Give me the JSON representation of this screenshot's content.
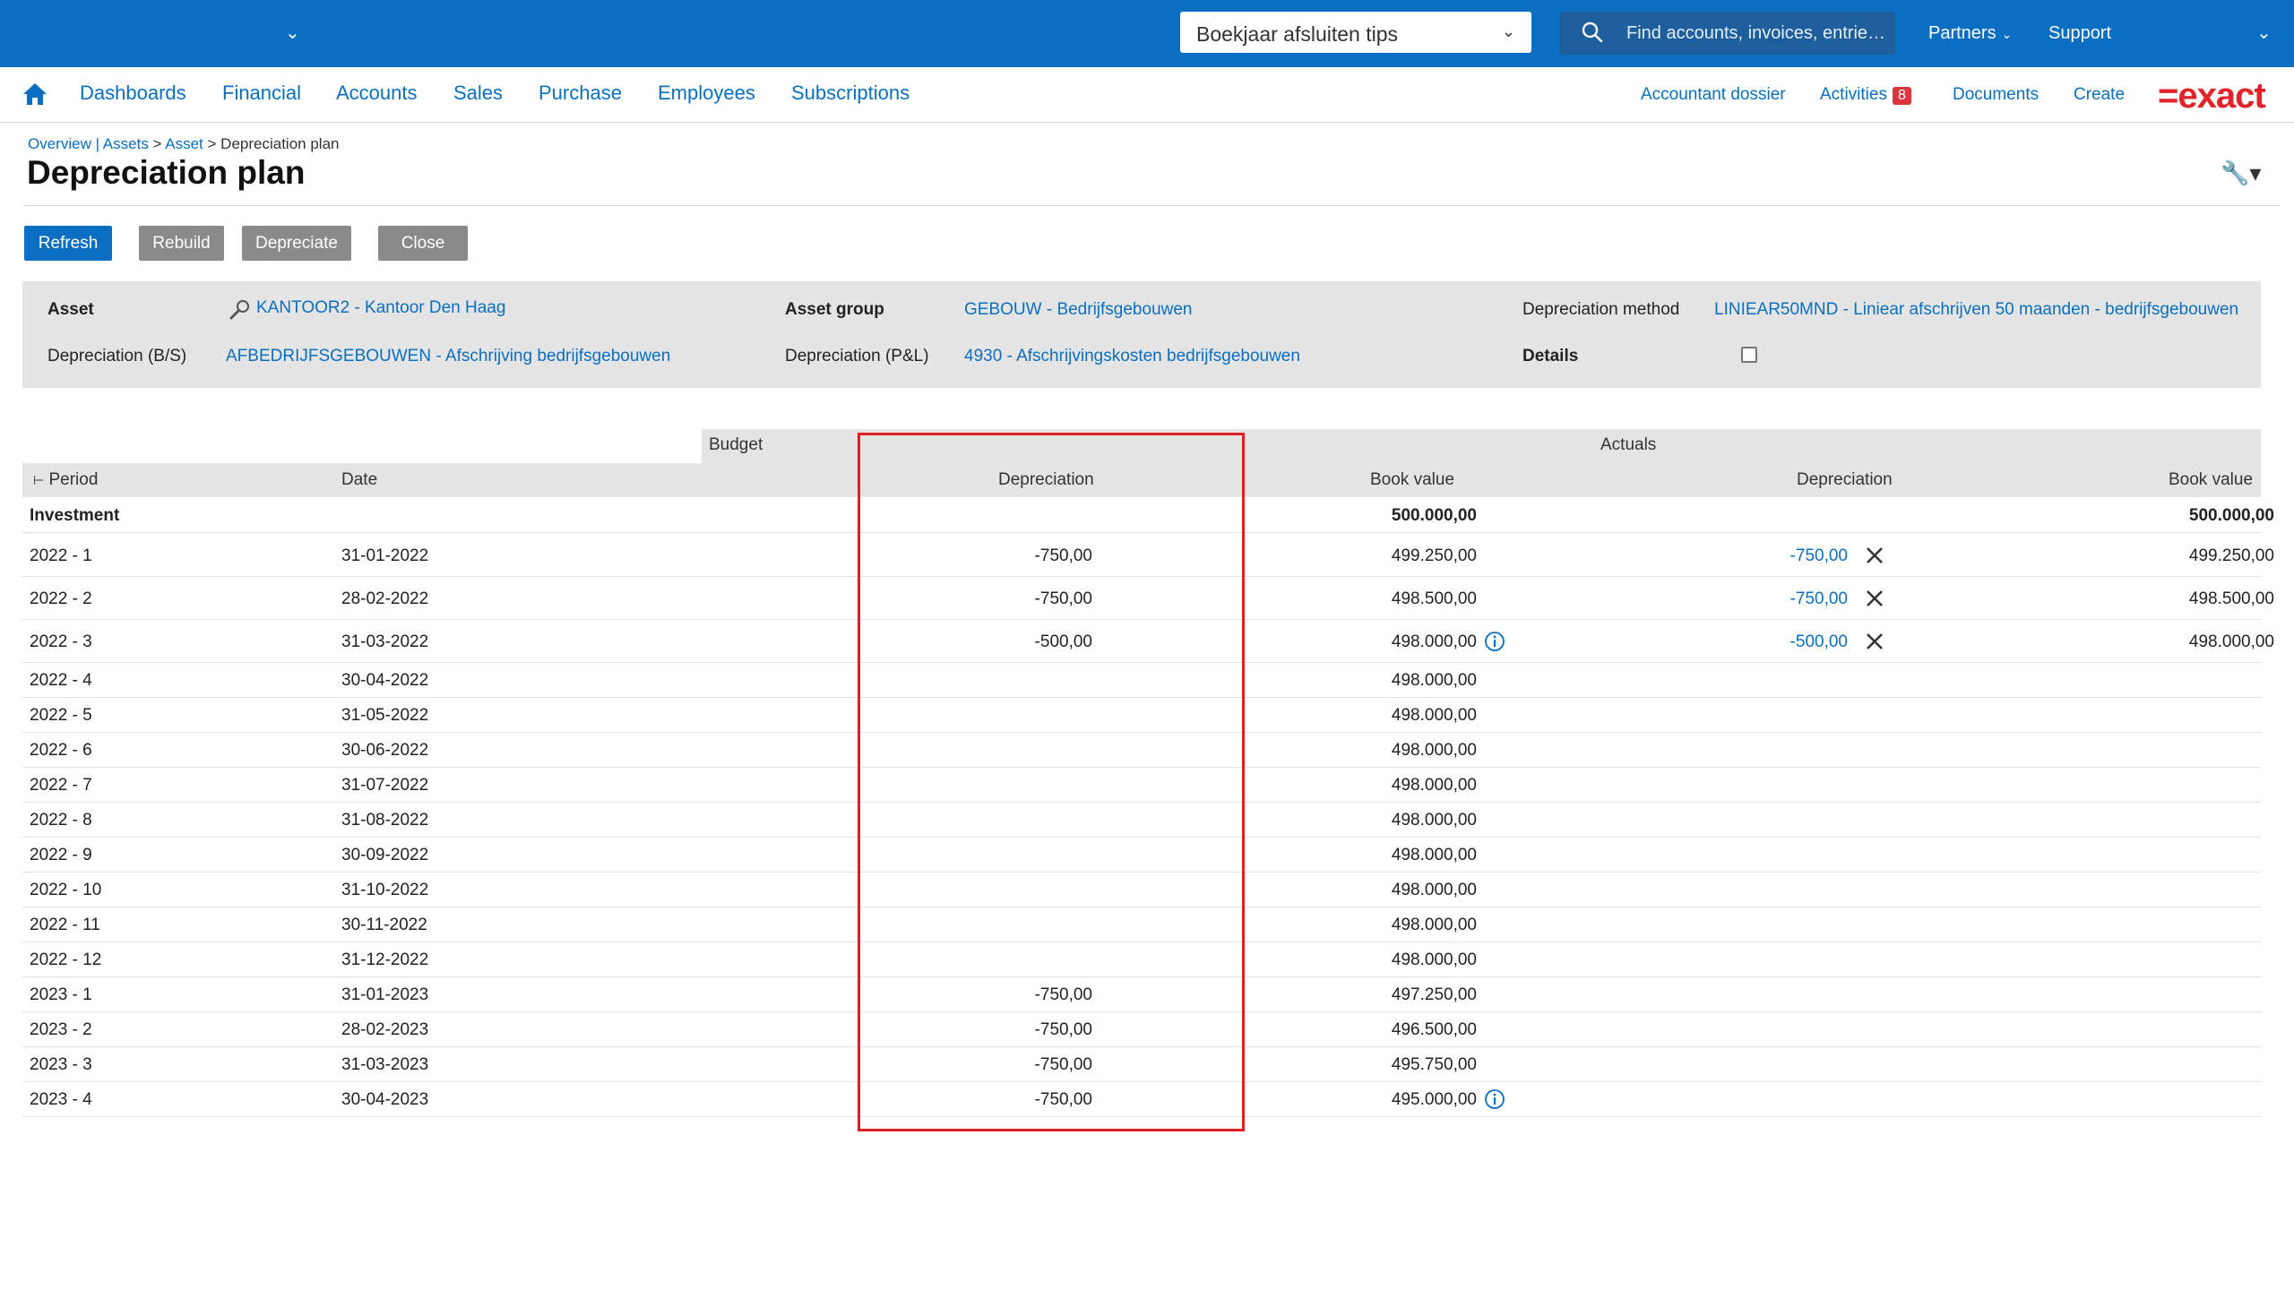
{
  "topbar": {
    "tips_select": "Boekjaar afsluiten tips",
    "search_placeholder": "Find accounts, invoices, entrie…",
    "partners": "Partners",
    "support": "Support"
  },
  "nav": {
    "items": [
      "Dashboards",
      "Financial",
      "Accounts",
      "Sales",
      "Purchase",
      "Employees",
      "Subscriptions"
    ],
    "right": {
      "accountant_dossier": "Accountant dossier",
      "activities": "Activities",
      "activities_count": "8",
      "documents": "Documents",
      "create": "Create"
    },
    "logo": "=exact"
  },
  "breadcrumb": {
    "overview": "Overview",
    "sep1": " | ",
    "assets": "Assets",
    "sep2": " > ",
    "asset": "Asset",
    "sep3": " > ",
    "current": "Depreciation plan"
  },
  "page_title": "Depreciation plan",
  "buttons": {
    "refresh": "Refresh",
    "rebuild": "Rebuild",
    "depreciate": "Depreciate",
    "close": "Close"
  },
  "info": {
    "asset_label": "Asset",
    "asset_value": "KANTOOR2 - Kantoor Den Haag",
    "asset_group_label": "Asset group",
    "asset_group_value": "GEBOUW - Bedrijfsgebouwen",
    "method_label": "Depreciation method",
    "method_value": "LINIEAR50MND - Liniear afschrijven 50 maanden - bedrijfsgebouwen",
    "dep_bs_label": "Depreciation (B/S)",
    "dep_bs_value": "AFBEDRIJFSGEBOUWEN - Afschrijving bedrijfsgebouwen",
    "dep_pl_label": "Depreciation (P&L)",
    "dep_pl_value": "4930 - Afschrijvingskosten bedrijfsgebouwen",
    "details_label": "Details",
    "details_checked": false
  },
  "table": {
    "group_budget": "Budget",
    "group_actuals": "Actuals",
    "headers": {
      "period": "Period",
      "date": "Date",
      "budget_depreciation": "Depreciation",
      "budget_book_value": "Book value",
      "actual_depreciation": "Depreciation",
      "actual_book_value": "Book value"
    },
    "investment": {
      "label": "Investment",
      "budget_book_value": "500.000,00",
      "actual_book_value": "500.000,00"
    },
    "rows": [
      {
        "period": "2022 - 1",
        "date": "31-01-2022",
        "bdep": "-750,00",
        "bbv": "499.250,00",
        "info": false,
        "adep": "-750,00",
        "abv": "499.250,00"
      },
      {
        "period": "2022 - 2",
        "date": "28-02-2022",
        "bdep": "-750,00",
        "bbv": "498.500,00",
        "info": false,
        "adep": "-750,00",
        "abv": "498.500,00"
      },
      {
        "period": "2022 - 3",
        "date": "31-03-2022",
        "bdep": "-500,00",
        "bbv": "498.000,00",
        "info": true,
        "adep": "-500,00",
        "abv": "498.000,00"
      },
      {
        "period": "2022 - 4",
        "date": "30-04-2022",
        "bdep": "",
        "bbv": "498.000,00",
        "info": false,
        "adep": "",
        "abv": ""
      },
      {
        "period": "2022 - 5",
        "date": "31-05-2022",
        "bdep": "",
        "bbv": "498.000,00",
        "info": false,
        "adep": "",
        "abv": ""
      },
      {
        "period": "2022 - 6",
        "date": "30-06-2022",
        "bdep": "",
        "bbv": "498.000,00",
        "info": false,
        "adep": "",
        "abv": ""
      },
      {
        "period": "2022 - 7",
        "date": "31-07-2022",
        "bdep": "",
        "bbv": "498.000,00",
        "info": false,
        "adep": "",
        "abv": ""
      },
      {
        "period": "2022 - 8",
        "date": "31-08-2022",
        "bdep": "",
        "bbv": "498.000,00",
        "info": false,
        "adep": "",
        "abv": ""
      },
      {
        "period": "2022 - 9",
        "date": "30-09-2022",
        "bdep": "",
        "bbv": "498.000,00",
        "info": false,
        "adep": "",
        "abv": ""
      },
      {
        "period": "2022 - 10",
        "date": "31-10-2022",
        "bdep": "",
        "bbv": "498.000,00",
        "info": false,
        "adep": "",
        "abv": ""
      },
      {
        "period": "2022 - 11",
        "date": "30-11-2022",
        "bdep": "",
        "bbv": "498.000,00",
        "info": false,
        "adep": "",
        "abv": ""
      },
      {
        "period": "2022 - 12",
        "date": "31-12-2022",
        "bdep": "",
        "bbv": "498.000,00",
        "info": false,
        "adep": "",
        "abv": ""
      },
      {
        "period": "2023 - 1",
        "date": "31-01-2023",
        "bdep": "-750,00",
        "bbv": "497.250,00",
        "info": false,
        "adep": "",
        "abv": ""
      },
      {
        "period": "2023 - 2",
        "date": "28-02-2023",
        "bdep": "-750,00",
        "bbv": "496.500,00",
        "info": false,
        "adep": "",
        "abv": ""
      },
      {
        "period": "2023 - 3",
        "date": "31-03-2023",
        "bdep": "-750,00",
        "bbv": "495.750,00",
        "info": false,
        "adep": "",
        "abv": ""
      },
      {
        "period": "2023 - 4",
        "date": "30-04-2023",
        "bdep": "-750,00",
        "bbv": "495.000,00",
        "info": true,
        "adep": "",
        "abv": ""
      }
    ]
  },
  "colors": {
    "brand_blue": "#0a6fc2",
    "highlight_red": "#e02020",
    "logo_red": "#e2232a"
  }
}
